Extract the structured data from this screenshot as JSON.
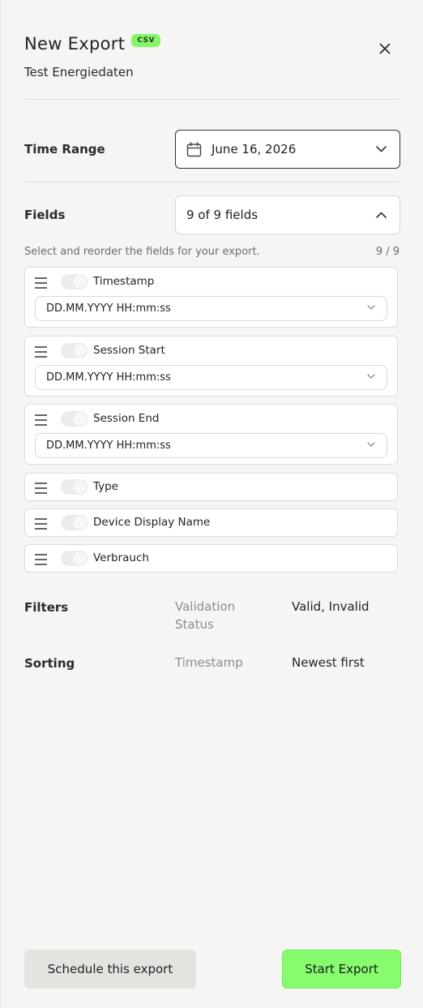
{
  "header": {
    "title": "New Export",
    "badge": "CSV",
    "subtitle": "Test Energiedaten"
  },
  "time_range": {
    "label": "Time Range",
    "value": "June 16, 2026"
  },
  "fields_section": {
    "label": "Fields",
    "value": "9 of 9 fields",
    "hint": "Select and reorder the fields for your export.",
    "count": "9 / 9",
    "items": [
      {
        "name": "Timestamp",
        "format": "DD.MM.YYYY HH:mm:ss"
      },
      {
        "name": "Session Start",
        "format": "DD.MM.YYYY HH:mm:ss"
      },
      {
        "name": "Session End",
        "format": "DD.MM.YYYY HH:mm:ss"
      },
      {
        "name": "Type"
      },
      {
        "name": "Device Display Name"
      },
      {
        "name": "Verbrauch"
      }
    ]
  },
  "filters": {
    "label": "Filters",
    "key": "Validation Status",
    "value": "Valid, Invalid"
  },
  "sorting": {
    "label": "Sorting",
    "key": "Timestamp",
    "value": "Newest first"
  },
  "actions": {
    "schedule_label": "Schedule this export",
    "start_label": "Start Export"
  },
  "colors": {
    "accent": "#86fc6e",
    "badge": "#86f569",
    "background": "#f5f5f3"
  },
  "icons": {
    "close": "close-icon",
    "calendar": "calendar-icon",
    "chevron_down": "chevron-down-icon",
    "chevron_up": "chevron-up-icon",
    "drag": "drag-handle-icon"
  }
}
